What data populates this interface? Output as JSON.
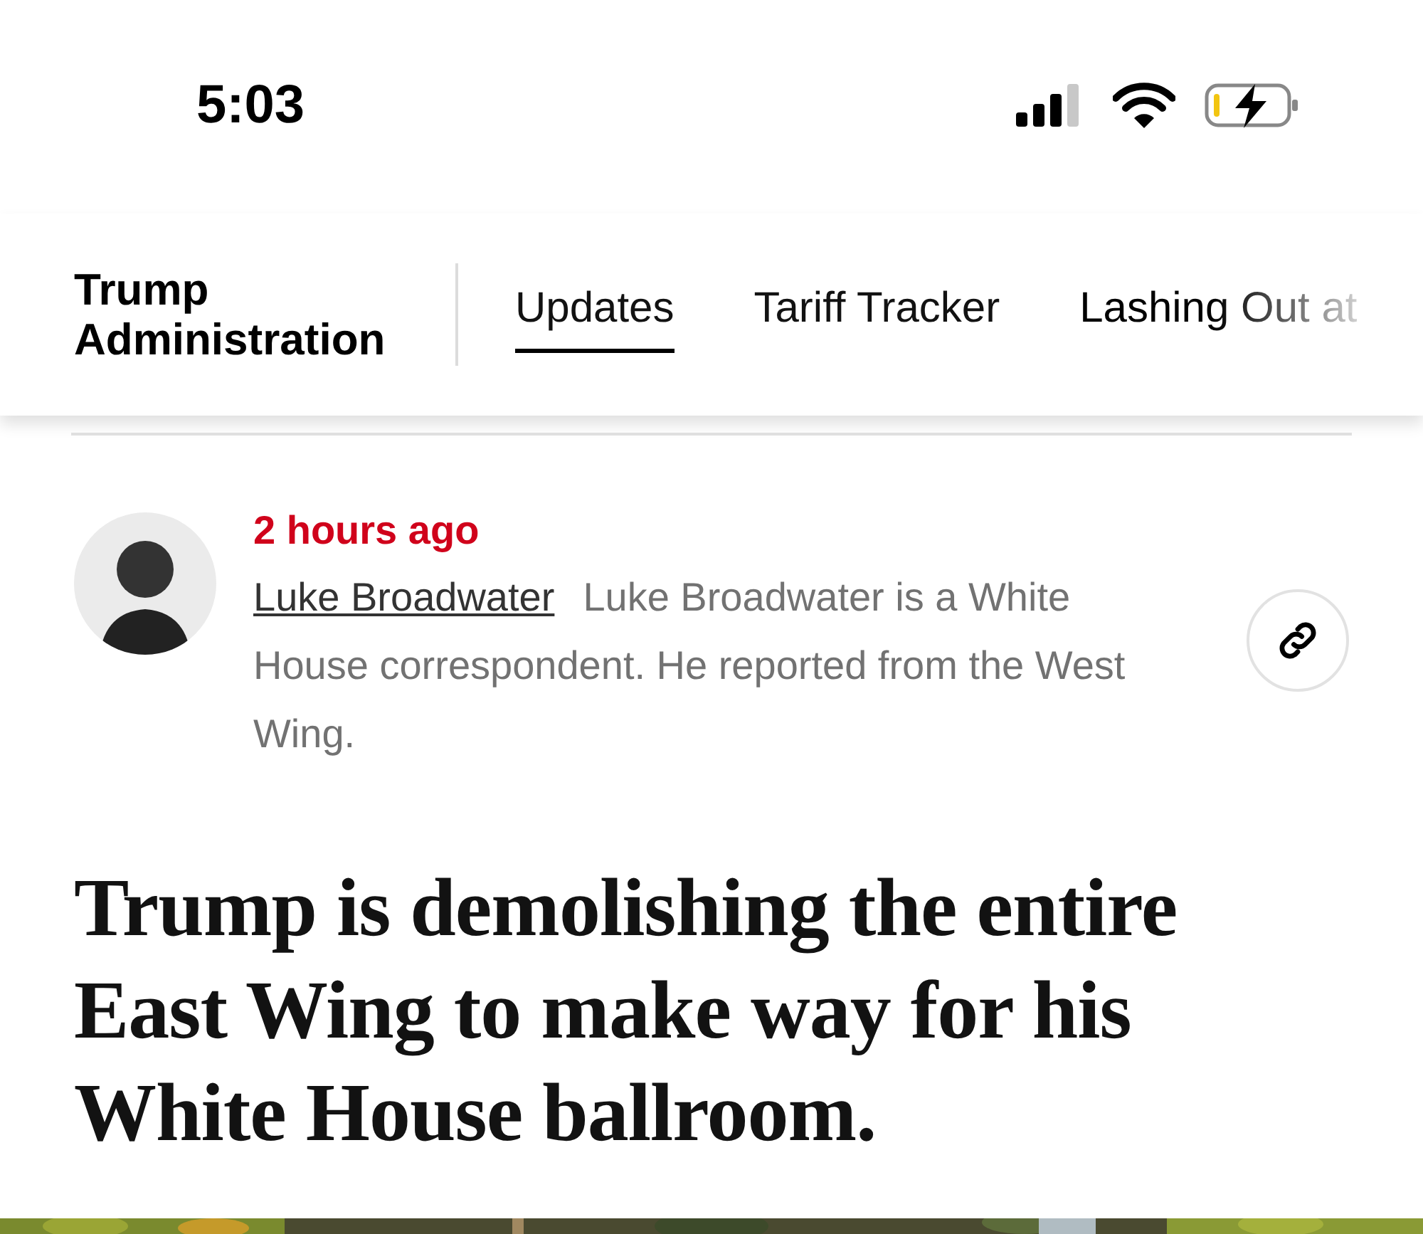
{
  "status_bar": {
    "time": "5:03"
  },
  "section": {
    "title": "Trump Administration"
  },
  "tabs": [
    {
      "label": "Updates",
      "selected": true
    },
    {
      "label": "Tariff Tracker",
      "selected": false
    },
    {
      "label": "Lashing Out at",
      "selected": false
    }
  ],
  "byline": {
    "timestamp": "2 hours ago",
    "author": "Luke Broadwater",
    "bio": "Luke Broadwater is a White House correspondent. He reported from the West Wing."
  },
  "headline": "Trump is demolishing the entire East Wing to make way for his White House ballroom."
}
